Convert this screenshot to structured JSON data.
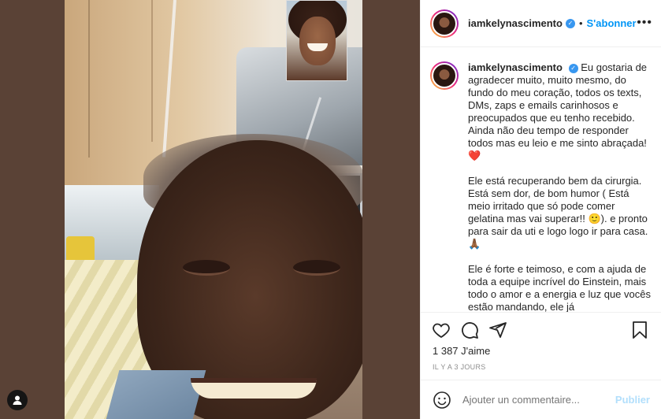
{
  "post": {
    "username": "iamkelynascimento",
    "follow_label": "S'abonner",
    "separator": "•",
    "verified_mark": "✓"
  },
  "caption": {
    "username": "iamkelynascimento",
    "paragraphs": [
      "Eu gostaria de agradecer muito, muito mesmo, do fundo do meu coração, todos os texts, DMs, zaps e emails carinhosos e preocupados que eu tenho recebido. Ainda não deu tempo de responder todos mas eu leio e me sinto abraçada! ❤️",
      "Ele está recuperando bem da cirurgia. Está sem dor, de bom humor ( Está meio irritado que só pode comer gelatina mas vai superar!! 🙂). e pronto para sair da uti e logo logo ir para casa. 🙏🏾",
      "Ele é forte e teimoso, e com a ajuda de toda a equipe incrível do Einstein, mais todo o amor e a energia e luz que vocês estão mandando, ele já"
    ]
  },
  "stats": {
    "likes": "1 387 J'aime",
    "time_ago": "IL Y A 3 JOURS"
  },
  "comment": {
    "placeholder": "Ajouter un commentaire...",
    "publish_label": "Publier"
  },
  "icons": {
    "like": "heart-icon",
    "comment": "comment-icon",
    "share": "share-icon",
    "save": "bookmark-icon",
    "emoji": "emoji-icon",
    "more": "more-icon",
    "account": "account-icon"
  },
  "colors": {
    "accent": "#0095f6",
    "verified": "#3897f0",
    "publish_disabled": "#b2dffc",
    "media_background": "#5a4236"
  }
}
